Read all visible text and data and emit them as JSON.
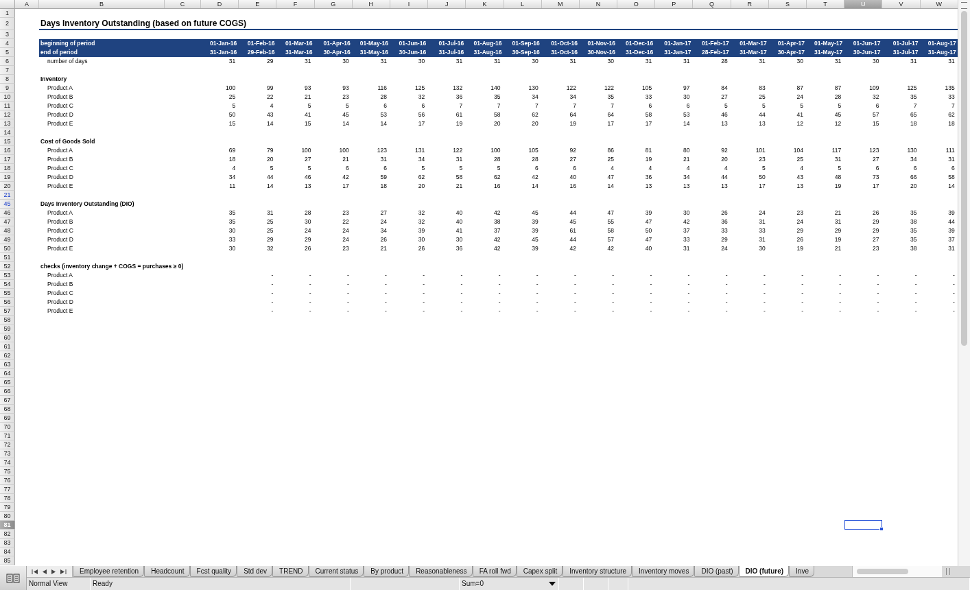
{
  "sheet": {
    "columns": [
      {
        "label": "A",
        "selected": false
      },
      {
        "label": "B",
        "selected": false
      },
      {
        "label": "C",
        "selected": false
      },
      {
        "label": "D",
        "selected": false
      },
      {
        "label": "E",
        "selected": false
      },
      {
        "label": "F",
        "selected": false
      },
      {
        "label": "G",
        "selected": false
      },
      {
        "label": "H",
        "selected": false
      },
      {
        "label": "I",
        "selected": false
      },
      {
        "label": "J",
        "selected": false
      },
      {
        "label": "K",
        "selected": false
      },
      {
        "label": "L",
        "selected": false
      },
      {
        "label": "M",
        "selected": false
      },
      {
        "label": "N",
        "selected": false
      },
      {
        "label": "O",
        "selected": false
      },
      {
        "label": "P",
        "selected": false
      },
      {
        "label": "Q",
        "selected": false
      },
      {
        "label": "R",
        "selected": false
      },
      {
        "label": "S",
        "selected": false
      },
      {
        "label": "T",
        "selected": false
      },
      {
        "label": "U",
        "selected": true
      },
      {
        "label": "V",
        "selected": false
      },
      {
        "label": "W",
        "selected": false
      }
    ],
    "rows": [
      {
        "label": "1",
        "selected": false,
        "hidden_boundary": false
      },
      {
        "label": "2",
        "selected": false,
        "hidden_boundary": false
      },
      {
        "label": "3",
        "selected": false,
        "hidden_boundary": false
      },
      {
        "label": "4",
        "selected": false,
        "hidden_boundary": false
      },
      {
        "label": "5",
        "selected": false,
        "hidden_boundary": false
      },
      {
        "label": "6",
        "selected": false,
        "hidden_boundary": false
      },
      {
        "label": "7",
        "selected": false,
        "hidden_boundary": false
      },
      {
        "label": "8",
        "selected": false,
        "hidden_boundary": false
      },
      {
        "label": "9",
        "selected": false,
        "hidden_boundary": false
      },
      {
        "label": "10",
        "selected": false,
        "hidden_boundary": false
      },
      {
        "label": "11",
        "selected": false,
        "hidden_boundary": false
      },
      {
        "label": "12",
        "selected": false,
        "hidden_boundary": false
      },
      {
        "label": "13",
        "selected": false,
        "hidden_boundary": false
      },
      {
        "label": "14",
        "selected": false,
        "hidden_boundary": false
      },
      {
        "label": "15",
        "selected": false,
        "hidden_boundary": false
      },
      {
        "label": "16",
        "selected": false,
        "hidden_boundary": false
      },
      {
        "label": "17",
        "selected": false,
        "hidden_boundary": false
      },
      {
        "label": "18",
        "selected": false,
        "hidden_boundary": false
      },
      {
        "label": "19",
        "selected": false,
        "hidden_boundary": false
      },
      {
        "label": "20",
        "selected": false,
        "hidden_boundary": false
      },
      {
        "label": "21",
        "selected": false,
        "hidden_boundary": true
      },
      {
        "label": "45",
        "selected": false,
        "hidden_boundary": true
      },
      {
        "label": "46",
        "selected": false,
        "hidden_boundary": false
      },
      {
        "label": "47",
        "selected": false,
        "hidden_boundary": false
      },
      {
        "label": "48",
        "selected": false,
        "hidden_boundary": false
      },
      {
        "label": "49",
        "selected": false,
        "hidden_boundary": false
      },
      {
        "label": "50",
        "selected": false,
        "hidden_boundary": false
      },
      {
        "label": "51",
        "selected": false,
        "hidden_boundary": false
      },
      {
        "label": "52",
        "selected": false,
        "hidden_boundary": false
      },
      {
        "label": "53",
        "selected": false,
        "hidden_boundary": false
      },
      {
        "label": "54",
        "selected": false,
        "hidden_boundary": false
      },
      {
        "label": "55",
        "selected": false,
        "hidden_boundary": false
      },
      {
        "label": "56",
        "selected": false,
        "hidden_boundary": false
      },
      {
        "label": "57",
        "selected": false,
        "hidden_boundary": false
      },
      {
        "label": "58",
        "selected": false,
        "hidden_boundary": false
      },
      {
        "label": "59",
        "selected": false,
        "hidden_boundary": false
      },
      {
        "label": "60",
        "selected": false,
        "hidden_boundary": false
      },
      {
        "label": "61",
        "selected": false,
        "hidden_boundary": false
      },
      {
        "label": "62",
        "selected": false,
        "hidden_boundary": false
      },
      {
        "label": "63",
        "selected": false,
        "hidden_boundary": false
      },
      {
        "label": "64",
        "selected": false,
        "hidden_boundary": false
      },
      {
        "label": "65",
        "selected": false,
        "hidden_boundary": false
      },
      {
        "label": "66",
        "selected": false,
        "hidden_boundary": false
      },
      {
        "label": "67",
        "selected": false,
        "hidden_boundary": false
      },
      {
        "label": "68",
        "selected": false,
        "hidden_boundary": false
      },
      {
        "label": "69",
        "selected": false,
        "hidden_boundary": false
      },
      {
        "label": "70",
        "selected": false,
        "hidden_boundary": false
      },
      {
        "label": "71",
        "selected": false,
        "hidden_boundary": false
      },
      {
        "label": "72",
        "selected": false,
        "hidden_boundary": false
      },
      {
        "label": "73",
        "selected": false,
        "hidden_boundary": false
      },
      {
        "label": "74",
        "selected": false,
        "hidden_boundary": false
      },
      {
        "label": "75",
        "selected": false,
        "hidden_boundary": false
      },
      {
        "label": "76",
        "selected": false,
        "hidden_boundary": false
      },
      {
        "label": "77",
        "selected": false,
        "hidden_boundary": false
      },
      {
        "label": "78",
        "selected": false,
        "hidden_boundary": false
      },
      {
        "label": "79",
        "selected": false,
        "hidden_boundary": false
      },
      {
        "label": "80",
        "selected": false,
        "hidden_boundary": false
      },
      {
        "label": "81",
        "selected": true,
        "hidden_boundary": false
      },
      {
        "label": "82",
        "selected": false,
        "hidden_boundary": false
      },
      {
        "label": "83",
        "selected": false,
        "hidden_boundary": false
      },
      {
        "label": "84",
        "selected": false,
        "hidden_boundary": false
      },
      {
        "label": "85",
        "selected": false,
        "hidden_boundary": false
      }
    ],
    "title": "Days Inventory Outstanding (based on future COGS)",
    "period_header": {
      "begin_label": "beginning of period",
      "end_label": "end of period",
      "days_label": "number of days",
      "periods": [
        {
          "begin": "01-Jan-16",
          "end": "31-Jan-16",
          "days": "31"
        },
        {
          "begin": "01-Feb-16",
          "end": "29-Feb-16",
          "days": "29"
        },
        {
          "begin": "01-Mar-16",
          "end": "31-Mar-16",
          "days": "31"
        },
        {
          "begin": "01-Apr-16",
          "end": "30-Apr-16",
          "days": "30"
        },
        {
          "begin": "01-May-16",
          "end": "31-May-16",
          "days": "31"
        },
        {
          "begin": "01-Jun-16",
          "end": "30-Jun-16",
          "days": "30"
        },
        {
          "begin": "01-Jul-16",
          "end": "31-Jul-16",
          "days": "31"
        },
        {
          "begin": "01-Aug-16",
          "end": "31-Aug-16",
          "days": "31"
        },
        {
          "begin": "01-Sep-16",
          "end": "30-Sep-16",
          "days": "30"
        },
        {
          "begin": "01-Oct-16",
          "end": "31-Oct-16",
          "days": "31"
        },
        {
          "begin": "01-Nov-16",
          "end": "30-Nov-16",
          "days": "30"
        },
        {
          "begin": "01-Dec-16",
          "end": "31-Dec-16",
          "days": "31"
        },
        {
          "begin": "01-Jan-17",
          "end": "31-Jan-17",
          "days": "31"
        },
        {
          "begin": "01-Feb-17",
          "end": "28-Feb-17",
          "days": "28"
        },
        {
          "begin": "01-Mar-17",
          "end": "31-Mar-17",
          "days": "31"
        },
        {
          "begin": "01-Apr-17",
          "end": "30-Apr-17",
          "days": "30"
        },
        {
          "begin": "01-May-17",
          "end": "31-May-17",
          "days": "31"
        },
        {
          "begin": "01-Jun-17",
          "end": "30-Jun-17",
          "days": "30"
        },
        {
          "begin": "01-Jul-17",
          "end": "31-Jul-17",
          "days": "31"
        },
        {
          "begin": "01-Aug-17",
          "end": "31-Aug-17",
          "days": "31"
        }
      ]
    },
    "sections": [
      {
        "title": "Inventory",
        "rows": [
          {
            "label": "Product A",
            "values": [
              "100",
              "99",
              "93",
              "93",
              "116",
              "125",
              "132",
              "140",
              "130",
              "122",
              "122",
              "105",
              "97",
              "84",
              "83",
              "87",
              "87",
              "109",
              "125",
              "135"
            ]
          },
          {
            "label": "Product B",
            "values": [
              "25",
              "22",
              "21",
              "23",
              "28",
              "32",
              "36",
              "35",
              "34",
              "34",
              "35",
              "33",
              "30",
              "27",
              "25",
              "24",
              "28",
              "32",
              "35",
              "33"
            ]
          },
          {
            "label": "Product C",
            "values": [
              "5",
              "4",
              "5",
              "5",
              "6",
              "6",
              "7",
              "7",
              "7",
              "7",
              "7",
              "6",
              "6",
              "5",
              "5",
              "5",
              "5",
              "6",
              "7",
              "7"
            ]
          },
          {
            "label": "Product D",
            "values": [
              "50",
              "43",
              "41",
              "45",
              "53",
              "56",
              "61",
              "58",
              "62",
              "64",
              "64",
              "58",
              "53",
              "46",
              "44",
              "41",
              "45",
              "57",
              "65",
              "62"
            ]
          },
          {
            "label": "Product E",
            "values": [
              "15",
              "14",
              "15",
              "14",
              "14",
              "17",
              "19",
              "20",
              "20",
              "19",
              "17",
              "17",
              "14",
              "13",
              "13",
              "12",
              "12",
              "15",
              "18",
              "18"
            ]
          }
        ]
      },
      {
        "title": "Cost of Goods Sold",
        "rows": [
          {
            "label": "Product A",
            "values": [
              "69",
              "79",
              "100",
              "100",
              "123",
              "131",
              "122",
              "100",
              "105",
              "92",
              "86",
              "81",
              "80",
              "92",
              "101",
              "104",
              "117",
              "123",
              "130",
              "111"
            ]
          },
          {
            "label": "Product B",
            "values": [
              "18",
              "20",
              "27",
              "21",
              "31",
              "34",
              "31",
              "28",
              "28",
              "27",
              "25",
              "19",
              "21",
              "20",
              "23",
              "25",
              "31",
              "27",
              "34",
              "31"
            ]
          },
          {
            "label": "Product C",
            "values": [
              "4",
              "5",
              "5",
              "6",
              "6",
              "5",
              "5",
              "5",
              "6",
              "6",
              "4",
              "4",
              "4",
              "4",
              "5",
              "4",
              "5",
              "6",
              "6",
              "6"
            ]
          },
          {
            "label": "Product D",
            "values": [
              "34",
              "44",
              "46",
              "42",
              "59",
              "62",
              "58",
              "62",
              "42",
              "40",
              "47",
              "36",
              "34",
              "44",
              "50",
              "43",
              "48",
              "73",
              "66",
              "58"
            ]
          },
          {
            "label": "Product E",
            "values": [
              "11",
              "14",
              "13",
              "17",
              "18",
              "20",
              "21",
              "16",
              "14",
              "16",
              "14",
              "13",
              "13",
              "13",
              "17",
              "13",
              "19",
              "17",
              "20",
              "14"
            ]
          }
        ]
      },
      {
        "title": "Days Inventory Outstanding (DIO)",
        "rows": [
          {
            "label": "Product A",
            "values": [
              "35",
              "31",
              "28",
              "23",
              "27",
              "32",
              "40",
              "42",
              "45",
              "44",
              "47",
              "39",
              "30",
              "26",
              "24",
              "23",
              "21",
              "26",
              "35",
              "39"
            ]
          },
          {
            "label": "Product B",
            "values": [
              "35",
              "25",
              "30",
              "22",
              "24",
              "32",
              "40",
              "38",
              "39",
              "45",
              "55",
              "47",
              "42",
              "36",
              "31",
              "24",
              "31",
              "29",
              "38",
              "44"
            ]
          },
          {
            "label": "Product C",
            "values": [
              "30",
              "25",
              "24",
              "24",
              "34",
              "39",
              "41",
              "37",
              "39",
              "61",
              "58",
              "50",
              "37",
              "33",
              "33",
              "29",
              "29",
              "29",
              "35",
              "39"
            ]
          },
          {
            "label": "Product D",
            "values": [
              "33",
              "29",
              "29",
              "24",
              "26",
              "30",
              "30",
              "42",
              "45",
              "44",
              "57",
              "47",
              "33",
              "29",
              "31",
              "26",
              "19",
              "27",
              "35",
              "37"
            ]
          },
          {
            "label": "Product E",
            "values": [
              "30",
              "32",
              "26",
              "23",
              "21",
              "26",
              "36",
              "42",
              "39",
              "42",
              "42",
              "40",
              "31",
              "24",
              "30",
              "19",
              "21",
              "23",
              "38",
              "31"
            ]
          }
        ]
      },
      {
        "title": "checks (inventory change + COGS = purchases ≥ 0)",
        "rows": [
          {
            "label": "Product A",
            "values": [
              "-",
              "-",
              "-",
              "-",
              "-",
              "-",
              "-",
              "-",
              "-",
              "-",
              "-",
              "-",
              "-",
              "-",
              "-",
              "-",
              "-",
              "-",
              "-"
            ]
          },
          {
            "label": "Product B",
            "values": [
              "-",
              "-",
              "-",
              "-",
              "-",
              "-",
              "-",
              "-",
              "-",
              "-",
              "-",
              "-",
              "-",
              "-",
              "-",
              "-",
              "-",
              "-",
              "-"
            ]
          },
          {
            "label": "Product C",
            "values": [
              "-",
              "-",
              "-",
              "-",
              "-",
              "-",
              "-",
              "-",
              "-",
              "-",
              "-",
              "-",
              "-",
              "-",
              "-",
              "-",
              "-",
              "-",
              "-"
            ]
          },
          {
            "label": "Product D",
            "values": [
              "-",
              "-",
              "-",
              "-",
              "-",
              "-",
              "-",
              "-",
              "-",
              "-",
              "-",
              "-",
              "-",
              "-",
              "-",
              "-",
              "-",
              "-",
              "-"
            ]
          },
          {
            "label": "Product E",
            "values": [
              "-",
              "-",
              "-",
              "-",
              "-",
              "-",
              "-",
              "-",
              "-",
              "-",
              "-",
              "-",
              "-",
              "-",
              "-",
              "-",
              "-",
              "-",
              "-"
            ]
          }
        ]
      }
    ]
  },
  "sheet_tabs": [
    {
      "label": "Employee retention",
      "selected": false
    },
    {
      "label": "Headcount",
      "selected": false
    },
    {
      "label": "Fcst quality",
      "selected": false
    },
    {
      "label": "Std dev",
      "selected": false
    },
    {
      "label": "TREND",
      "selected": false
    },
    {
      "label": "Current status",
      "selected": false
    },
    {
      "label": "By product",
      "selected": false
    },
    {
      "label": "Reasonableness",
      "selected": false
    },
    {
      "label": "FA roll fwd",
      "selected": false
    },
    {
      "label": "Capex split",
      "selected": false
    },
    {
      "label": "Inventory structure",
      "selected": false
    },
    {
      "label": "Inventory moves",
      "selected": false
    },
    {
      "label": "DIO (past)",
      "selected": false
    },
    {
      "label": "DIO (future)",
      "selected": true
    },
    {
      "label": "Inve",
      "selected": false
    }
  ],
  "status_bar": {
    "view": "Normal View",
    "state": "Ready",
    "sum": "Sum=0"
  }
}
